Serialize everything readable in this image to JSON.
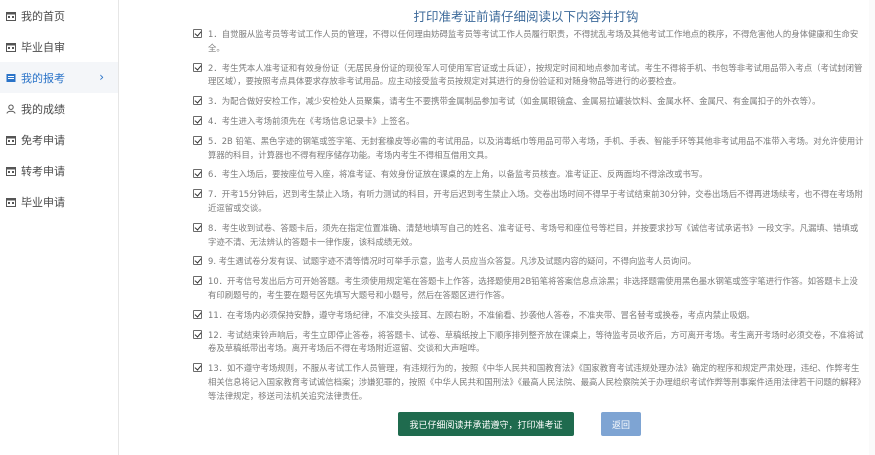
{
  "sidebar": {
    "items": [
      {
        "label": "我的首页",
        "icon": "calendar-icon"
      },
      {
        "label": "毕业自审",
        "icon": "calendar-icon"
      },
      {
        "label": "我的报考",
        "icon": "document-icon",
        "active": true
      },
      {
        "label": "我的成绩",
        "icon": "user-icon"
      },
      {
        "label": "免考申请",
        "icon": "calendar-icon"
      },
      {
        "label": "转考申请",
        "icon": "calendar-icon"
      },
      {
        "label": "毕业申请",
        "icon": "calendar-icon"
      }
    ],
    "active_chevron": "›",
    "accent_color": "#2a73c8"
  },
  "main": {
    "title": "打印准考证前请仔细阅读以下内容并打钩",
    "rules": [
      "1．自觉服从监考员等考试工作人员的管理，不得以任何理由妨碍监考员等考试工作人员履行职责，不得扰乱考场及其他考试工作地点的秩序，不得危害他人的身体健康和生命安全。",
      "2．考生凭本人准考证和有效身份证（无居民身份证的现役军人可使用军官证或士兵证），按规定时间和地点参加考试。考生不得将手机、书包等非考试用品带入考点（考试封闭管理区域），要按照考点具体要求存放非考试用品。应主动接受监考员按规定对其进行的身份验证和对随身物品等进行的必要检查。",
      "3．为配合做好安检工作，减少安检处人员聚集，请考生不要携带金属制品参加考试（如金属眼镜盒、金属易拉罐装饮料、金属水杯、金属尺、有金属扣子的外衣等）。",
      "4．考生进入考场前须先在《考场信息记录卡》上签名。",
      "5．2B 铅笔、黑色字迹的钢笔或签字笔、无封套橡皮等必需的考试用品，以及消毒纸巾等用品可带入考场，手机、手表、智能手环等其他非考试用品不准带入考场。对允许使用计算器的科目，计算器也不得有程序储存功能。考场内考生不得相互借用文具。",
      "6．考生入场后，要按座位号入座，将准考证、有效身份证放在课桌的左上角，以备监考员核查。准考证正、反两面均不得涂改或书写。",
      "7．开考15分钟后，迟到考生禁止入场，有听力测试的科目，开考后迟到考生禁止入场。交卷出场时间不得早于考试结束前30分钟，交卷出场后不得再进场续考，也不得在考场附近逗留或交谈。",
      "8．考生收到试卷、答题卡后，须先在指定位置准确、清楚地填写自己的姓名、准考证号、考场号和座位号等栏目，并按要求抄写《诚信考试承诺书》一段文字。凡漏填、错填或字迹不清、无法辨认的答题卡一律作废，该科成绩无效。",
      "9. 考生遇试卷分发有误、试题字迹不清等情况时可举手示意，监考人员应当众答复。凡涉及试题内容的疑问，不得向监考人员询问。",
      "10．开考信号发出后方可开始答题。考生须使用规定笔在答题卡上作答，选择题使用2B铅笔将答案信息点涂黑；非选择题需使用黑色墨水钢笔或签字笔进行作答。如答题卡上没有印刷题号的，考生要在题号区先填写大题号和小题号，然后在答题区进行作答。",
      "11．在考场内必须保持安静，遵守考场纪律，不准交头接耳、左顾右盼，不准偷看、抄袭他人答卷，不准夹带、冒名替考或换卷，考点内禁止吸烟。",
      "12．考试结束铃声响后，考生立即停止答卷，将答题卡、试卷、草稿纸按上下顺序排列整齐放在课桌上，等待监考员收齐后，方可离开考场。考生离开考场时必须交卷，不准将试卷及草稿纸带出考场。离开考场后不得在考场附近逗留、交谈和大声喧哗。",
      "13．如不遵守考场规则，不服从考试工作人员管理，有违规行为的，按照《中华人民共和国教育法》《国家教育考试违规处理办法》确定的程序和规定严肃处理，违纪、作弊考生相关信息将记入国家教育考试诚信档案；涉嫌犯罪的，按照《中华人民共和国刑法》《最高人民法院、最高人民检察院关于办理组织考试作弊等刑事案件适用法律若干问题的解释》等法律规定，移送司法机关追究法律责任。"
    ],
    "print_button": "我已仔细阅读并承诺遵守，打印准考证",
    "back_button": "返回",
    "print_color": "#1f6b4e",
    "back_color": "#7ea4d3",
    "title_color": "#3d6a9a"
  }
}
